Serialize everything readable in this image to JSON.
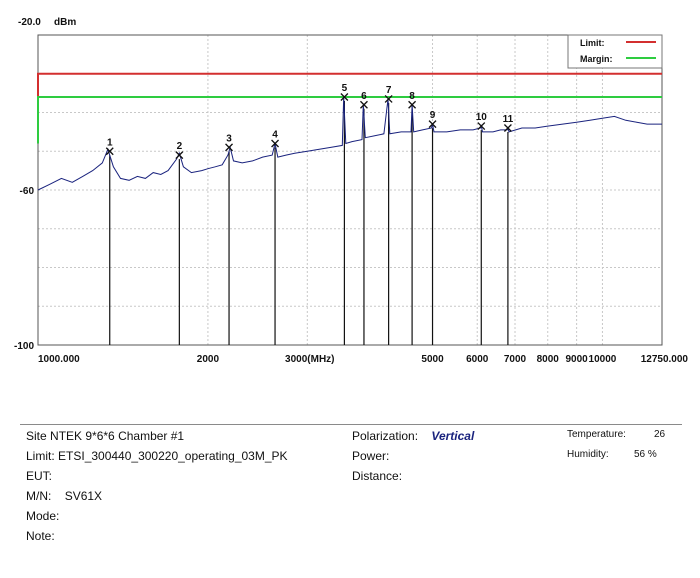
{
  "chart_data": {
    "type": "line",
    "y_unit": "dBm",
    "x_unit": "MHz",
    "x_scale": "log",
    "xlim": [
      1000,
      12750
    ],
    "ylim": [
      -100,
      -20
    ],
    "x_ticks": [
      {
        "value": 1000,
        "label": "1000.000"
      },
      {
        "value": 2000,
        "label": "2000"
      },
      {
        "value": 3000,
        "label": "3000"
      },
      {
        "value": 5000,
        "label": "5000"
      },
      {
        "value": 6000,
        "label": "6000"
      },
      {
        "value": 7000,
        "label": "7000"
      },
      {
        "value": 8000,
        "label": "8000"
      },
      {
        "value": 9000,
        "label": "9000"
      },
      {
        "value": 10000,
        "label": "10000"
      },
      {
        "value": 12750,
        "label": "12750.000"
      }
    ],
    "x_unit_label": "(MHz)",
    "y_ticks": [
      {
        "value": -20,
        "label": "-20.0"
      },
      {
        "value": -60,
        "label": "-60"
      },
      {
        "value": -100,
        "label": "-100"
      }
    ],
    "grid": true,
    "legend_position": "top-right",
    "limit_line": {
      "name": "Limit:",
      "color": "#d32f2f",
      "value": -30
    },
    "margin_line": {
      "name": "Margin:",
      "color": "#2ecc40",
      "value": -36
    },
    "trace_color": "#1a237e",
    "markers": [
      {
        "label": "1",
        "x": 1340,
        "y": -50
      },
      {
        "label": "2",
        "x": 1780,
        "y": -51
      },
      {
        "label": "3",
        "x": 2180,
        "y": -49
      },
      {
        "label": "4",
        "x": 2630,
        "y": -48
      },
      {
        "label": "5",
        "x": 3490,
        "y": -36
      },
      {
        "label": "6",
        "x": 3780,
        "y": -38
      },
      {
        "label": "7",
        "x": 4180,
        "y": -36.5
      },
      {
        "label": "8",
        "x": 4600,
        "y": -38
      },
      {
        "label": "9",
        "x": 5000,
        "y": -43
      },
      {
        "label": "10",
        "x": 6100,
        "y": -43.5
      },
      {
        "label": "11",
        "x": 6800,
        "y": -44
      }
    ],
    "trace": [
      [
        1000,
        -60
      ],
      [
        1050,
        -58.5
      ],
      [
        1100,
        -57
      ],
      [
        1150,
        -58
      ],
      [
        1200,
        -56.5
      ],
      [
        1250,
        -55
      ],
      [
        1300,
        -53
      ],
      [
        1330,
        -49.5
      ],
      [
        1360,
        -54
      ],
      [
        1400,
        -57
      ],
      [
        1450,
        -57.5
      ],
      [
        1500,
        -56.5
      ],
      [
        1550,
        -57
      ],
      [
        1600,
        -55.5
      ],
      [
        1650,
        -56
      ],
      [
        1700,
        -55
      ],
      [
        1760,
        -52
      ],
      [
        1780,
        -50.5
      ],
      [
        1810,
        -54
      ],
      [
        1870,
        -55.5
      ],
      [
        1950,
        -55
      ],
      [
        2000,
        -54.5
      ],
      [
        2060,
        -54
      ],
      [
        2120,
        -53.5
      ],
      [
        2170,
        -51
      ],
      [
        2190,
        -49
      ],
      [
        2220,
        -52.5
      ],
      [
        2300,
        -53
      ],
      [
        2400,
        -52.5
      ],
      [
        2500,
        -51.5
      ],
      [
        2600,
        -51
      ],
      [
        2630,
        -48
      ],
      [
        2660,
        -51.5
      ],
      [
        2750,
        -51
      ],
      [
        2850,
        -50.5
      ],
      [
        3000,
        -50
      ],
      [
        3150,
        -49.5
      ],
      [
        3300,
        -49
      ],
      [
        3460,
        -48.5
      ],
      [
        3480,
        -36
      ],
      [
        3510,
        -48
      ],
      [
        3600,
        -47.5
      ],
      [
        3750,
        -47
      ],
      [
        3770,
        -38
      ],
      [
        3800,
        -46.5
      ],
      [
        3950,
        -46
      ],
      [
        4100,
        -45.5
      ],
      [
        4170,
        -36.5
      ],
      [
        4200,
        -45.5
      ],
      [
        4400,
        -45
      ],
      [
        4580,
        -45
      ],
      [
        4600,
        -38
      ],
      [
        4630,
        -45
      ],
      [
        4800,
        -44.5
      ],
      [
        4980,
        -44
      ],
      [
        5000,
        -43
      ],
      [
        5030,
        -45
      ],
      [
        5300,
        -45
      ],
      [
        5600,
        -44.5
      ],
      [
        5900,
        -44.5
      ],
      [
        6080,
        -44
      ],
      [
        6100,
        -43.5
      ],
      [
        6130,
        -45
      ],
      [
        6400,
        -45
      ],
      [
        6600,
        -44.5
      ],
      [
        6780,
        -44.5
      ],
      [
        6800,
        -44
      ],
      [
        6830,
        -45
      ],
      [
        7200,
        -44
      ],
      [
        7600,
        -44
      ],
      [
        8000,
        -43.5
      ],
      [
        8500,
        -43
      ],
      [
        9000,
        -42.5
      ],
      [
        9500,
        -42
      ],
      [
        10000,
        -41.5
      ],
      [
        10500,
        -41
      ],
      [
        11000,
        -42
      ],
      [
        11500,
        -42.5
      ],
      [
        12000,
        -43
      ],
      [
        12500,
        -43
      ],
      [
        12750,
        -43
      ]
    ]
  },
  "info": {
    "site_label": "Site",
    "site_value": "NTEK 9*6*6 Chamber #1",
    "limit_label": "Limit:",
    "limit_value": "ETSI_300440_300220_operating_03M_PK",
    "eut_label": "EUT:",
    "mn_label": "M/N:",
    "mn_value": "SV61X",
    "mode_label": "Mode:",
    "note_label": "Note:",
    "polarization_label": "Polarization:",
    "polarization_value": "Vertical",
    "power_label": "Power:",
    "distance_label": "Distance:",
    "temperature_label": "Temperature:",
    "temperature_value": "26",
    "humidity_label": "Humidity:",
    "humidity_value": "56 %"
  }
}
